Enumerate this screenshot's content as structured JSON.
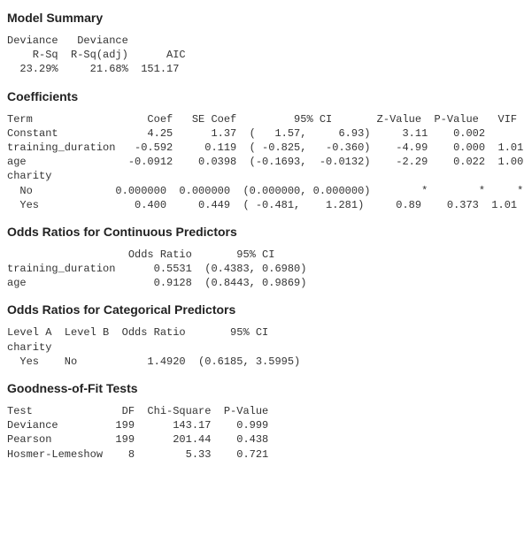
{
  "sections": {
    "model_summary": {
      "title": "Model Summary",
      "header1": "Deviance   Deviance",
      "header2": "    R-Sq  R-Sq(adj)      AIC",
      "row": "  23.29%     21.68%  151.17"
    },
    "coefficients": {
      "title": "Coefficients",
      "header": "Term                  Coef   SE Coef         95% CI       Z-Value  P-Value   VIF",
      "rows": [
        "Constant              4.25      1.37  (   1.57,     6.93)     3.11    0.002",
        "training_duration   -0.592     0.119  ( -0.825,   -0.360)    -4.99    0.000  1.01",
        "age                -0.0912    0.0398  (-0.1693,  -0.0132)    -2.29    0.022  1.00",
        "charity",
        "  No             0.000000  0.000000  (0.000000, 0.000000)        *        *     *",
        "  Yes               0.400     0.449  ( -0.481,    1.281)     0.89    0.373  1.01"
      ]
    },
    "odds_cont": {
      "title": "Odds Ratios for Continuous Predictors",
      "header": "                   Odds Ratio       95% CI",
      "rows": [
        "training_duration      0.5531  (0.4383, 0.6980)",
        "age                    0.9128  (0.8443, 0.9869)"
      ]
    },
    "odds_cat": {
      "title": "Odds Ratios for Categorical Predictors",
      "header": "Level A  Level B  Odds Ratio       95% CI",
      "rows": [
        "charity",
        "  Yes    No           1.4920  (0.6185, 3.5995)"
      ]
    },
    "gof": {
      "title": "Goodness-of-Fit Tests",
      "header": "Test              DF  Chi-Square  P-Value",
      "rows": [
        "Deviance         199      143.17    0.999",
        "Pearson          199      201.44    0.438",
        "Hosmer-Lemeshow    8        5.33    0.721"
      ]
    }
  }
}
